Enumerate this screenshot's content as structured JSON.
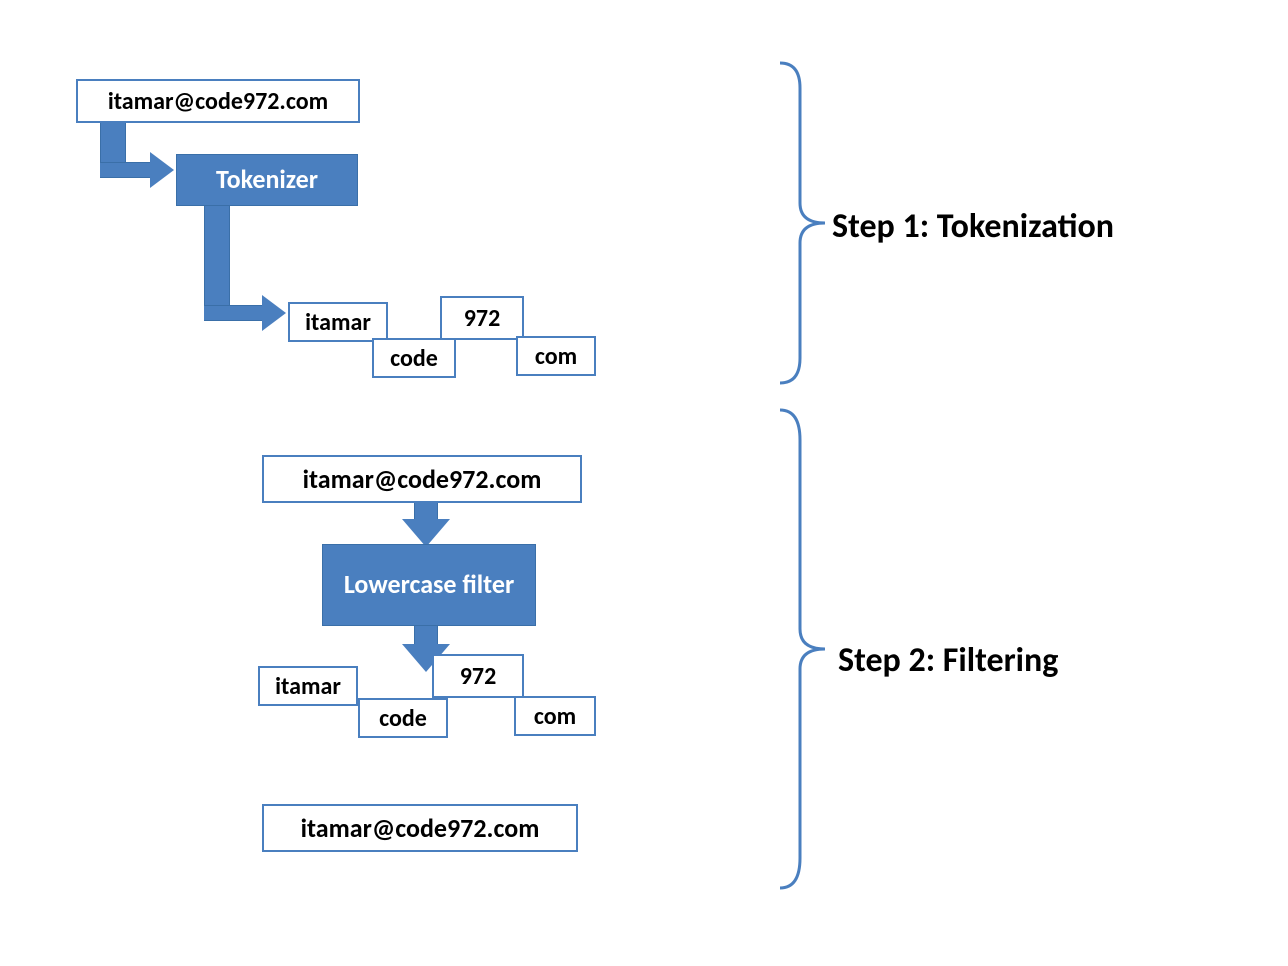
{
  "step1": {
    "label": "Step 1: Tokenization",
    "input": "itamar@code972.com",
    "processor": "Tokenizer",
    "tokens": {
      "t1": "itamar",
      "t2": "code",
      "t3": "972",
      "t4": "com"
    }
  },
  "step2": {
    "label": "Step 2: Filtering",
    "input": "itamar@code972.com",
    "processor": "Lowercase filter",
    "tokens": {
      "t1": "itamar",
      "t2": "code",
      "t3": "972",
      "t4": "com"
    },
    "output": "itamar@code972.com"
  },
  "colors": {
    "blue": "#4a7fbf",
    "border": "#3a6fa8"
  }
}
